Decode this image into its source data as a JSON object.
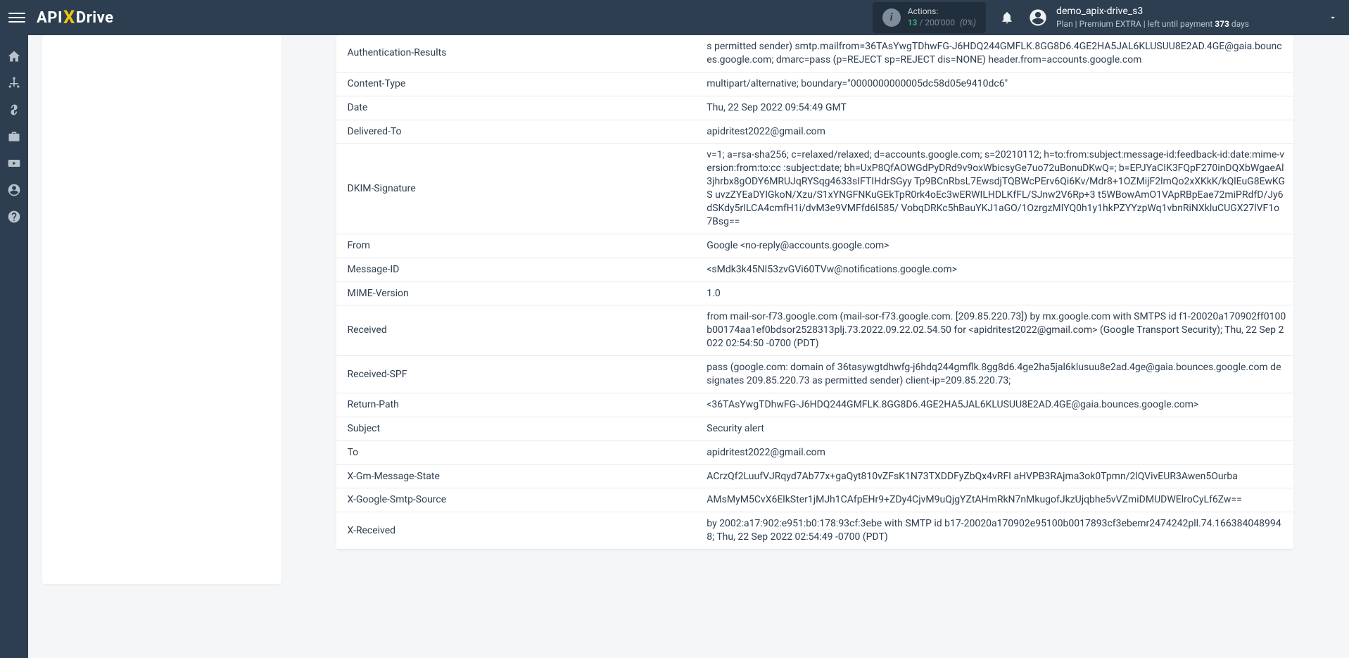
{
  "header": {
    "logo_parts": {
      "api": "API",
      "x": "X",
      "drive": "Drive"
    },
    "actions": {
      "label": "Actions:",
      "current": "13",
      "separator": "/",
      "max": "200'000",
      "percent": "(0%)"
    },
    "username": "demo_apix-drive_s3",
    "plan_prefix": "Plan |",
    "plan_name": "Premium EXTRA",
    "plan_mid": "| left until payment",
    "plan_days": "373",
    "plan_days_unit": "days"
  },
  "sidebar": {
    "items": [
      {
        "name": "home-icon"
      },
      {
        "name": "connections-icon"
      },
      {
        "name": "billing-icon"
      },
      {
        "name": "briefcase-icon"
      },
      {
        "name": "video-icon"
      },
      {
        "name": "profile-icon"
      },
      {
        "name": "help-icon"
      }
    ]
  },
  "rows": [
    {
      "key": "Authentication-Results",
      "val": "s permitted sender) smtp.mailfrom=36TAsYwgTDhwFG-J6HDQ244GMFLK.8GG8D6.4GE2HA5JAL6KLUSUU8E2AD.4GE@gaia.bounces.google.com; dmarc=pass (p=REJECT sp=REJECT dis=NONE) header.from=accounts.google.com"
    },
    {
      "key": "Content-Type",
      "val": "multipart/alternative; boundary=\"0000000000005dc58d05e9410dc6\""
    },
    {
      "key": "Date",
      "val": "Thu, 22 Sep 2022 09:54:49 GMT"
    },
    {
      "key": "Delivered-To",
      "val": "apidritest2022@gmail.com"
    },
    {
      "key": "DKIM-Signature",
      "val": "v=1; a=rsa-sha256; c=relaxed/relaxed; d=accounts.google.com; s=20210112; h=to:from:subject:message-id:feedback-id:date:mime-version:from:to:cc :subject:date; bh=UxP8QfAOWGdPyDRd9v9oxWbicsyGe7uo72uBonuDKwQ=; b=EPJYaCIK3FQpF270inDQXbWgaeAl3jhrbx8gODY6MRUJqRYSqg4633sIFTIHdrSGyy Tp9BCnRbsL7EwsdjTQBWcPErv6Qi6Kv/Mdr8+1OZMijF2lmQo2xXKkK/kQlEuG8EwKGS uvzZYEaDYIGkoN/Xzu/S1xYNGFNKuGEkTpR0rk4oEc3wERWILHDLKfFL/SJnw2V6Rp+3 t5WBowAmO1VApRBpEae72miPRdfD/Jy6dSKdy5rILCA4cmfH1i/dvM3e9VMFfd6l585/ VobqDRKc5hBauYKJ1aGO/1OzrgzMIYQ0h1y1hkPZYYzpWq1vbnRiNXkluCUGX27lVF1o 7Bsg=="
    },
    {
      "key": "From",
      "val": "Google <no-reply@accounts.google.com>"
    },
    {
      "key": "Message-ID",
      "val": "<sMdk3k45NI53zvGVi60TVw@notifications.google.com>"
    },
    {
      "key": "MIME-Version",
      "val": "1.0"
    },
    {
      "key": "Received",
      "val": "from mail-sor-f73.google.com (mail-sor-f73.google.com. [209.85.220.73]) by mx.google.com with SMTPS id f1-20020a170902ff0100b00174aa1ef0bdsor2528313plj.73.2022.09.22.02.54.50 for <apidritest2022@gmail.com> (Google Transport Security); Thu, 22 Sep 2022 02:54:50 -0700 (PDT)"
    },
    {
      "key": "Received-SPF",
      "val": "pass (google.com: domain of 36tasywgtdhwfg-j6hdq244gmflk.8gg8d6.4ge2ha5jal6klusuu8e2ad.4ge@gaia.bounces.google.com designates 209.85.220.73 as permitted sender) client-ip=209.85.220.73;"
    },
    {
      "key": "Return-Path",
      "val": "<36TAsYwgTDhwFG-J6HDQ244GMFLK.8GG8D6.4GE2HA5JAL6KLUSUU8E2AD.4GE@gaia.bounces.google.com>"
    },
    {
      "key": "Subject",
      "val": "Security alert"
    },
    {
      "key": "To",
      "val": "apidritest2022@gmail.com"
    },
    {
      "key": "X-Gm-Message-State",
      "val": "ACrzQf2LuufVJRqyd7Ab77x+gaQyt810vZFsK1N73TXDDFyZbQx4vRFI aHVPB3RAjma3ok0Tpmn/2lQVivEUR3Awen5Ourba"
    },
    {
      "key": "X-Google-Smtp-Source",
      "val": "AMsMyM5CvX6ElkSter1jMJh1CAfpEHr9+ZDy4CjvM9uQjgYZtAHmRkN7nMkugofJkzUjqbhe5vVZmiDMUDWElroCyLf6Zw=="
    },
    {
      "key": "X-Received",
      "val": "by 2002:a17:902:e951:b0:178:93cf:3ebe with SMTP id b17-20020a170902e95100b0017893cf3ebemr2474242pll.74.1663840489948; Thu, 22 Sep 2022 02:54:49 -0700 (PDT)"
    }
  ]
}
